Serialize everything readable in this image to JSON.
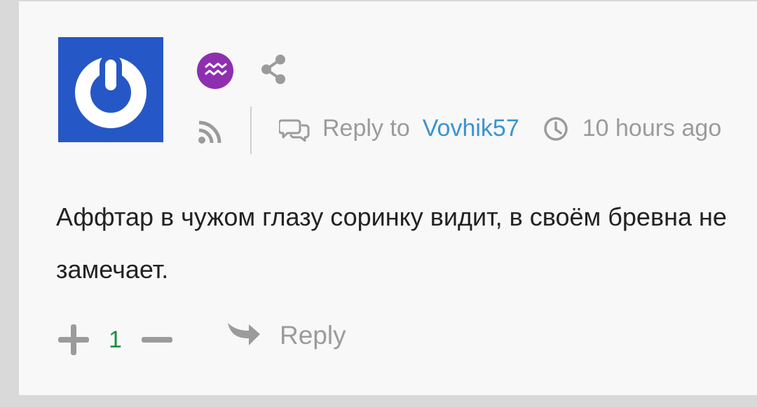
{
  "comment": {
    "meta": {
      "reply_to_label": "Reply to",
      "reply_to_user": "Vovhik57",
      "time_ago": "10 hours ago"
    },
    "text": "Аффтар в чужом глазу соринку видит, в своём бревна не замечает.",
    "votes": {
      "score": "1"
    },
    "actions": {
      "reply_label": "Reply"
    }
  },
  "icons": {
    "avatar": "power-button-logo",
    "zodiac": "aquarius-icon",
    "share": "share-icon",
    "rss": "rss-icon",
    "reply_to": "speech-bubbles-icon",
    "time": "clock-icon",
    "upvote": "plus-icon",
    "downvote": "minus-icon",
    "reply": "reply-arrow-icon"
  },
  "colors": {
    "avatar_bg": "#2557c6",
    "zodiac_bg": "#8e2fb0",
    "link": "#3b93d2",
    "score": "#1e8c43",
    "muted": "#9b9b9b",
    "text": "#222222"
  }
}
